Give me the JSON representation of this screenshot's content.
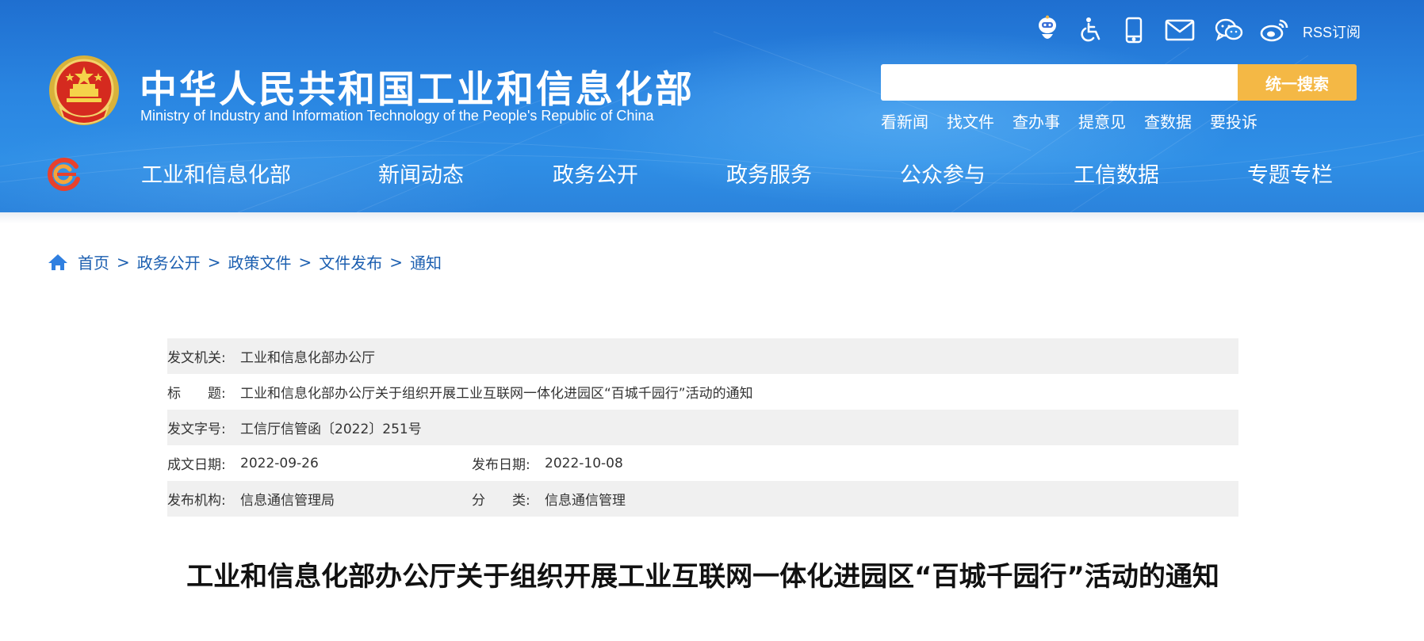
{
  "header": {
    "site_title": "中华人民共和国工业和信息化部",
    "site_subtitle": "Ministry of Industry and Information Technology of the People's Republic of China",
    "utility_icons": [
      "robot-assistant-icon",
      "accessibility-icon",
      "mobile-icon",
      "mail-icon",
      "wechat-icon",
      "weibo-icon"
    ],
    "rss_label": "RSS订阅",
    "search": {
      "placeholder": "",
      "button_label": "统一搜索"
    },
    "quick_links": [
      "看新闻",
      "找文件",
      "查办事",
      "提意见",
      "查数据",
      "要投诉"
    ]
  },
  "nav": {
    "items": [
      "工业和信息化部",
      "新闻动态",
      "政务公开",
      "政务服务",
      "公众参与",
      "工信数据",
      "专题专栏"
    ]
  },
  "breadcrumb": [
    "首页",
    "政务公开",
    "政策文件",
    "文件发布",
    "通知"
  ],
  "meta": {
    "issuer_label": "发文机关:",
    "issuer": "工业和信息化部办公厅",
    "title_label": "标　　题:",
    "title": "工业和信息化部办公厅关于组织开展工业互联网一体化进园区“百城千园行”活动的通知",
    "doc_number_label": "发文字号:",
    "doc_number": "工信厅信管函〔2022〕251号",
    "created_label": "成文日期:",
    "created": "2022-09-26",
    "published_label": "发布日期:",
    "published": "2022-10-08",
    "agency_label": "发布机构:",
    "agency": "信息通信管理局",
    "category_label": "分　　类:",
    "category": "信息通信管理"
  },
  "document": {
    "title": "工业和信息化部办公厅关于组织开展工业互联网一体化进园区“百城千园行”活动的通知"
  },
  "colors": {
    "header_blue": "#2a86e2",
    "search_button": "#f4b845",
    "link_blue": "#1c5fb0",
    "row_shade": "#f0f0f0"
  }
}
